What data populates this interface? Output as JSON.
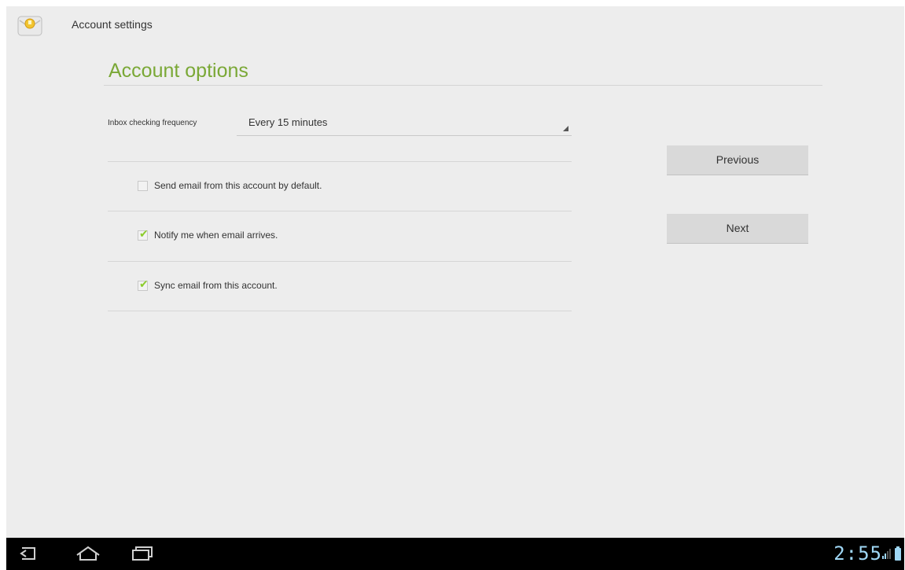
{
  "action_bar": {
    "title": "Account settings",
    "icon": "email-app-icon"
  },
  "section": {
    "title": "Account options"
  },
  "frequency": {
    "label": "Inbox checking frequency",
    "selected": "Every 15 minutes"
  },
  "options": [
    {
      "label": "Send email from this account by default.",
      "checked": false
    },
    {
      "label": "Notify me when email arrives.",
      "checked": true
    },
    {
      "label": "Sync email from this account.",
      "checked": true
    }
  ],
  "buttons": {
    "previous": "Previous",
    "next": "Next"
  },
  "system_bar": {
    "time": "2:55",
    "icons": [
      "back-icon",
      "home-icon",
      "recent-apps-icon",
      "signal-icon",
      "battery-icon"
    ]
  },
  "colors": {
    "accent": "#7aa836",
    "check": "#8ccc2c",
    "clock": "#9fd7f5",
    "background": "#ededed"
  }
}
